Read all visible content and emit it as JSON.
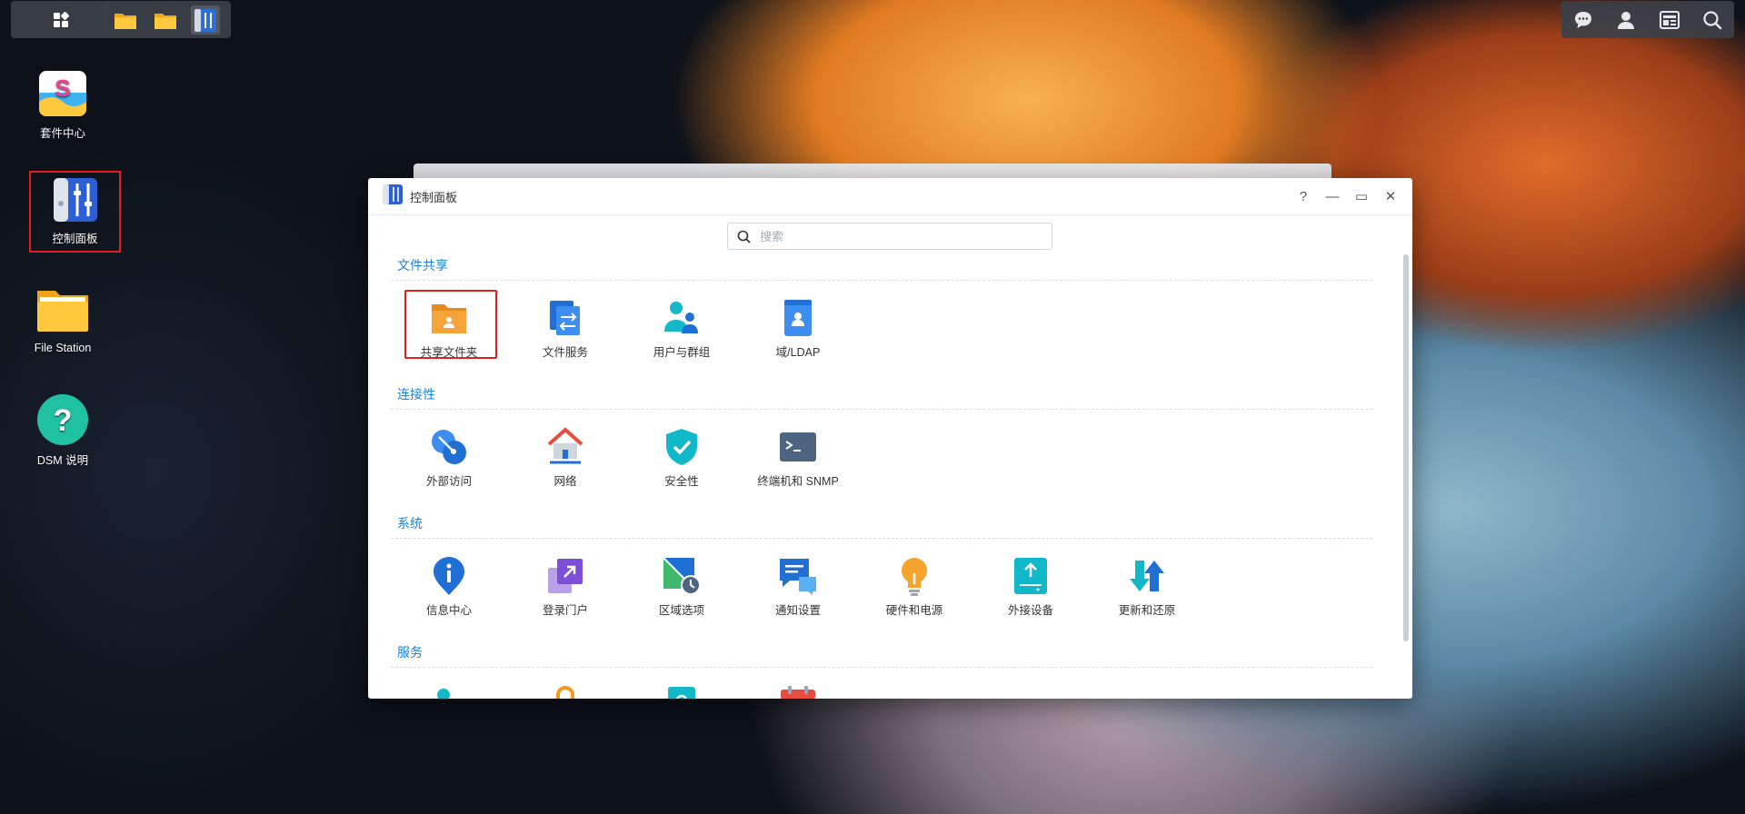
{
  "taskbar": {
    "main_menu_icon": "grid-icon",
    "apps": [
      "file-station-folder-icon",
      "folder-icon",
      "control-panel-icon"
    ],
    "right_icons": [
      "chat-icon",
      "user-icon",
      "widgets-icon",
      "search-icon"
    ]
  },
  "desktop": {
    "icons": [
      {
        "label": "套件中心",
        "icon": "package-center-icon"
      },
      {
        "label": "控制面板",
        "icon": "control-panel-icon"
      },
      {
        "label": "File Station",
        "icon": "folder-icon"
      },
      {
        "label": "DSM 说明",
        "icon": "help-icon"
      }
    ]
  },
  "window": {
    "title": "控制面板",
    "controls": {
      "help": "?",
      "minimize": "—",
      "maximize": "▭",
      "close": "✕"
    },
    "search_placeholder": "搜索"
  },
  "sections": [
    {
      "title": "文件共享",
      "items": [
        "共享文件夹",
        "文件服务",
        "用户与群组",
        "域/LDAP"
      ]
    },
    {
      "title": "连接性",
      "items": [
        "外部访问",
        "网络",
        "安全性",
        "终端机和 SNMP"
      ]
    },
    {
      "title": "系统",
      "items": [
        "信息中心",
        "登录门户",
        "区域选项",
        "通知设置",
        "硬件和电源",
        "外接设备",
        "更新和还原"
      ]
    },
    {
      "title": "服务",
      "items": []
    }
  ],
  "colors": {
    "accent": "#1a82d6",
    "highlight_box": "#e0201e"
  }
}
